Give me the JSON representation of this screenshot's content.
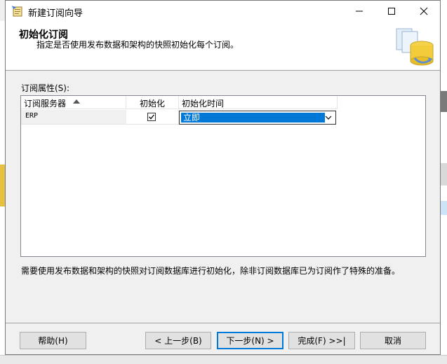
{
  "window": {
    "title": "新建订阅向导"
  },
  "header": {
    "title": "初始化订阅",
    "subtitle": "指定是否使用发布数据和架构的快照初始化每个订阅。"
  },
  "section": {
    "label": "订阅属性(S):"
  },
  "grid": {
    "columns": [
      "订阅服务器",
      "初始化",
      "初始化时间"
    ],
    "sorted_column": "订阅服务器",
    "rows": [
      {
        "subscriber": "ERP",
        "initialize": true,
        "init_time": "立即"
      }
    ]
  },
  "note": "需要使用发布数据和架构的快照对订阅数据库进行初始化，除非订阅数据库已为订阅作了特殊的准备。",
  "buttons": {
    "help": "帮助(H)",
    "back": "< 上一步(B)",
    "next": "下一步(N) >",
    "finish": "完成(F) >>|",
    "cancel": "取消"
  },
  "colors": {
    "accent": "#0078d7",
    "selection": "#0078d7",
    "window_bg": "#f0f0f0"
  },
  "icons": [
    "wizard-app-icon",
    "minimize-icon",
    "maximize-icon",
    "close-icon",
    "database-graphic",
    "sort-ascending-icon",
    "checkbox-checked-icon",
    "chevron-down-icon"
  ]
}
